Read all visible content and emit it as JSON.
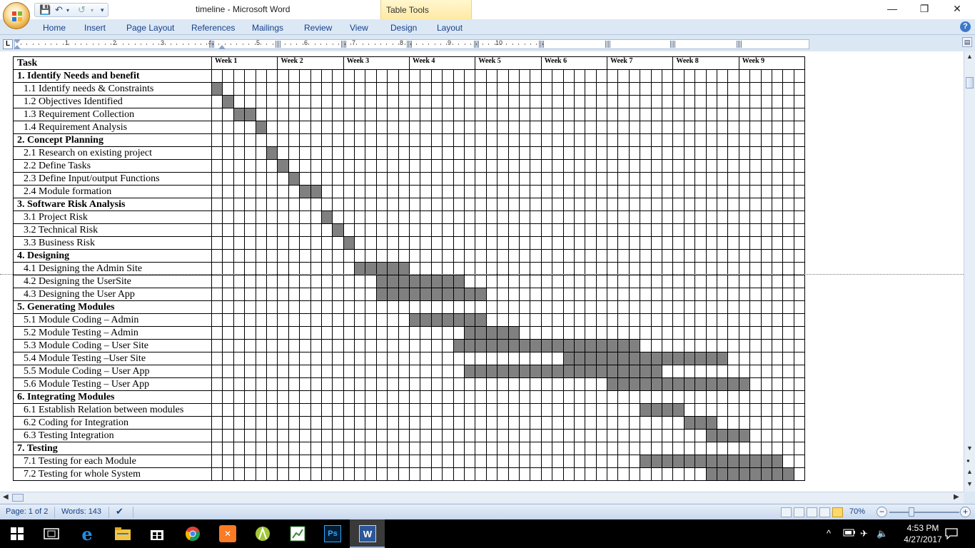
{
  "window": {
    "title": "timeline - Microsoft Word",
    "context_tab_group": "Table Tools",
    "controls": {
      "minimize": "—",
      "restore": "❐",
      "close": "✕"
    }
  },
  "ribbon_tabs": [
    "Home",
    "Insert",
    "Page Layout",
    "References",
    "Mailings",
    "Review",
    "View",
    "Design",
    "Layout"
  ],
  "ruler": {
    "numbers": [
      "1",
      "2",
      "3",
      "4",
      "5",
      "6",
      "7",
      "8",
      "9",
      "10"
    ]
  },
  "gantt": {
    "header_task": "Task",
    "weeks": [
      "Week 1",
      "Week 2",
      "Week 3",
      "Week 4",
      "Week 5",
      "Week 6",
      "Week 7",
      "Week 8",
      "Week 9"
    ],
    "days_per_week": 6,
    "rows": [
      {
        "label": "1. Identify Needs and benefit",
        "section": true,
        "start": 0,
        "end": 0
      },
      {
        "label": "1.1 Identify needs & Constraints",
        "section": false,
        "start": 1,
        "end": 1
      },
      {
        "label": "1.2 Objectives Identified",
        "section": false,
        "start": 2,
        "end": 2
      },
      {
        "label": "1.3 Requirement Collection",
        "section": false,
        "start": 3,
        "end": 4
      },
      {
        "label": "1.4 Requirement Analysis",
        "section": false,
        "start": 5,
        "end": 5
      },
      {
        "label": "2. Concept Planning",
        "section": true,
        "start": 0,
        "end": 0
      },
      {
        "label": "2.1 Research on existing project",
        "section": false,
        "start": 6,
        "end": 6
      },
      {
        "label": "2.2 Define Tasks",
        "section": false,
        "start": 7,
        "end": 7
      },
      {
        "label": "2.3 Define Input/output Functions",
        "section": false,
        "start": 8,
        "end": 8
      },
      {
        "label": "2.4 Module formation",
        "section": false,
        "start": 9,
        "end": 10
      },
      {
        "label": "3. Software Risk Analysis",
        "section": true,
        "start": 0,
        "end": 0
      },
      {
        "label": "3.1 Project Risk",
        "section": false,
        "start": 11,
        "end": 11
      },
      {
        "label": "3.2 Technical Risk",
        "section": false,
        "start": 12,
        "end": 12
      },
      {
        "label": "3.3 Business Risk",
        "section": false,
        "start": 13,
        "end": 13
      },
      {
        "label": "4. Designing",
        "section": true,
        "start": 0,
        "end": 0
      },
      {
        "label": "4.1 Designing the Admin Site",
        "section": false,
        "start": 14,
        "end": 18
      },
      {
        "label": "4.2 Designing the UserSite",
        "section": false,
        "start": 16,
        "end": 23
      },
      {
        "label": "4.3 Designing the User App",
        "section": false,
        "start": 16,
        "end": 25
      },
      {
        "label": "5. Generating Modules",
        "section": true,
        "start": 0,
        "end": 0
      },
      {
        "label": "5.1 Module Coding – Admin",
        "section": false,
        "start": 19,
        "end": 25
      },
      {
        "label": "5.2 Module Testing – Admin",
        "section": false,
        "start": 24,
        "end": 28
      },
      {
        "label": "5.3 Module Coding – User Site",
        "section": false,
        "start": 23,
        "end": 39
      },
      {
        "label": "5.4 Module Testing –User Site",
        "section": false,
        "start": 33,
        "end": 47
      },
      {
        "label": "5.5 Module Coding – User App",
        "section": false,
        "start": 24,
        "end": 41
      },
      {
        "label": "5.6 Module Testing – User App",
        "section": false,
        "start": 37,
        "end": 49
      },
      {
        "label": "6. Integrating Modules",
        "section": true,
        "start": 0,
        "end": 0
      },
      {
        "label": "6.1 Establish Relation between modules",
        "section": false,
        "start": 40,
        "end": 43
      },
      {
        "label": "6.2 Coding for Integration",
        "section": false,
        "start": 44,
        "end": 46
      },
      {
        "label": "6.3 Testing Integration",
        "section": false,
        "start": 46,
        "end": 49
      },
      {
        "label": "7. Testing",
        "section": true,
        "start": 0,
        "end": 0
      },
      {
        "label": "7.1 Testing for each Module",
        "section": false,
        "start": 40,
        "end": 52
      },
      {
        "label": "7.2 Testing for whole System",
        "section": false,
        "start": 46,
        "end": 53
      }
    ]
  },
  "status_bar": {
    "page": "Page: 1 of 2",
    "words": "Words: 143",
    "zoom": "70%"
  },
  "taskbar": {
    "apps": [
      "start-icon",
      "task-view-icon",
      "edge-icon",
      "file-explorer-icon",
      "store-icon",
      "chrome-icon",
      "xampp-icon",
      "android-studio-icon",
      "excel-like-icon",
      "photoshop-icon",
      "word-icon"
    ],
    "ps_label": "Ps",
    "word_label": "W",
    "time": "4:53 PM",
    "date": "4/27/2017"
  }
}
